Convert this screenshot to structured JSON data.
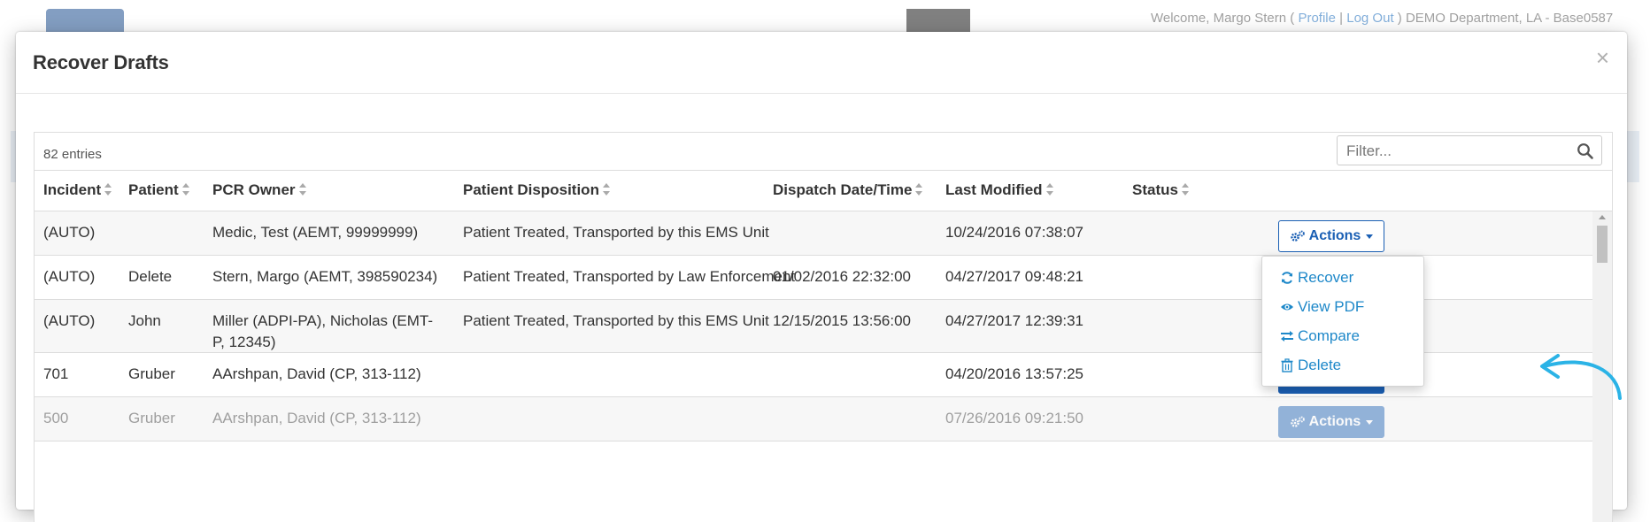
{
  "background": {
    "welcome": {
      "prefix": "Welcome, Margo Stern (",
      "profile": "Profile",
      "separator": "|",
      "logout": "Log Out",
      "suffix": ") DEMO Department, LA - Base0587"
    }
  },
  "modal": {
    "title": "Recover Drafts",
    "close_label": "×"
  },
  "table": {
    "entries_label": "82 entries",
    "filter_placeholder": "Filter...",
    "columns": {
      "incident": "Incident",
      "patient": "Patient",
      "pcr_owner": "PCR Owner",
      "disposition": "Patient Disposition",
      "dispatch": "Dispatch Date/Time",
      "modified": "Last Modified",
      "status": "Status"
    },
    "actions_label": "Actions",
    "rows": [
      {
        "incident": "(AUTO)",
        "patient": "",
        "pcr_owner": "Medic, Test (AEMT, 99999999)",
        "disposition": "Patient Treated, Transported by this EMS Unit",
        "dispatch": "",
        "modified": "10/24/2016 07:38:07",
        "status": ""
      },
      {
        "incident": "(AUTO)",
        "patient": "Delete",
        "pcr_owner": "Stern, Margo (AEMT, 398590234)",
        "disposition": "Patient Treated, Transported by Law Enforcement",
        "dispatch": "01/02/2016 22:32:00",
        "modified": "04/27/2017 09:48:21",
        "status": ""
      },
      {
        "incident": "(AUTO)",
        "patient": "John",
        "pcr_owner": "Miller (ADPI-PA), Nicholas (EMT-P, 12345)",
        "disposition": "Patient Treated, Transported by this EMS Unit",
        "dispatch": "12/15/2015 13:56:00",
        "modified": "04/27/2017 12:39:31",
        "status": ""
      },
      {
        "incident": "701",
        "patient": "Gruber",
        "pcr_owner": "AArshpan, David (CP, 313-112)",
        "disposition": "",
        "dispatch": "",
        "modified": "04/20/2016 13:57:25",
        "status": ""
      },
      {
        "incident": "500",
        "patient": "Gruber",
        "pcr_owner": "AArshpan, David (CP, 313-112)",
        "disposition": "",
        "dispatch": "",
        "modified": "07/26/2016 09:21:50",
        "status": ""
      }
    ]
  },
  "dropdown": {
    "items": [
      {
        "label": "Recover",
        "icon": "refresh-icon"
      },
      {
        "label": "View PDF",
        "icon": "eye-icon"
      },
      {
        "label": "Compare",
        "icon": "exchange-icon"
      },
      {
        "label": "Delete",
        "icon": "trash-icon"
      }
    ]
  },
  "colors": {
    "primary": "#1a5fb4",
    "link": "#1e88c9",
    "annotation": "#2bb3e6"
  }
}
